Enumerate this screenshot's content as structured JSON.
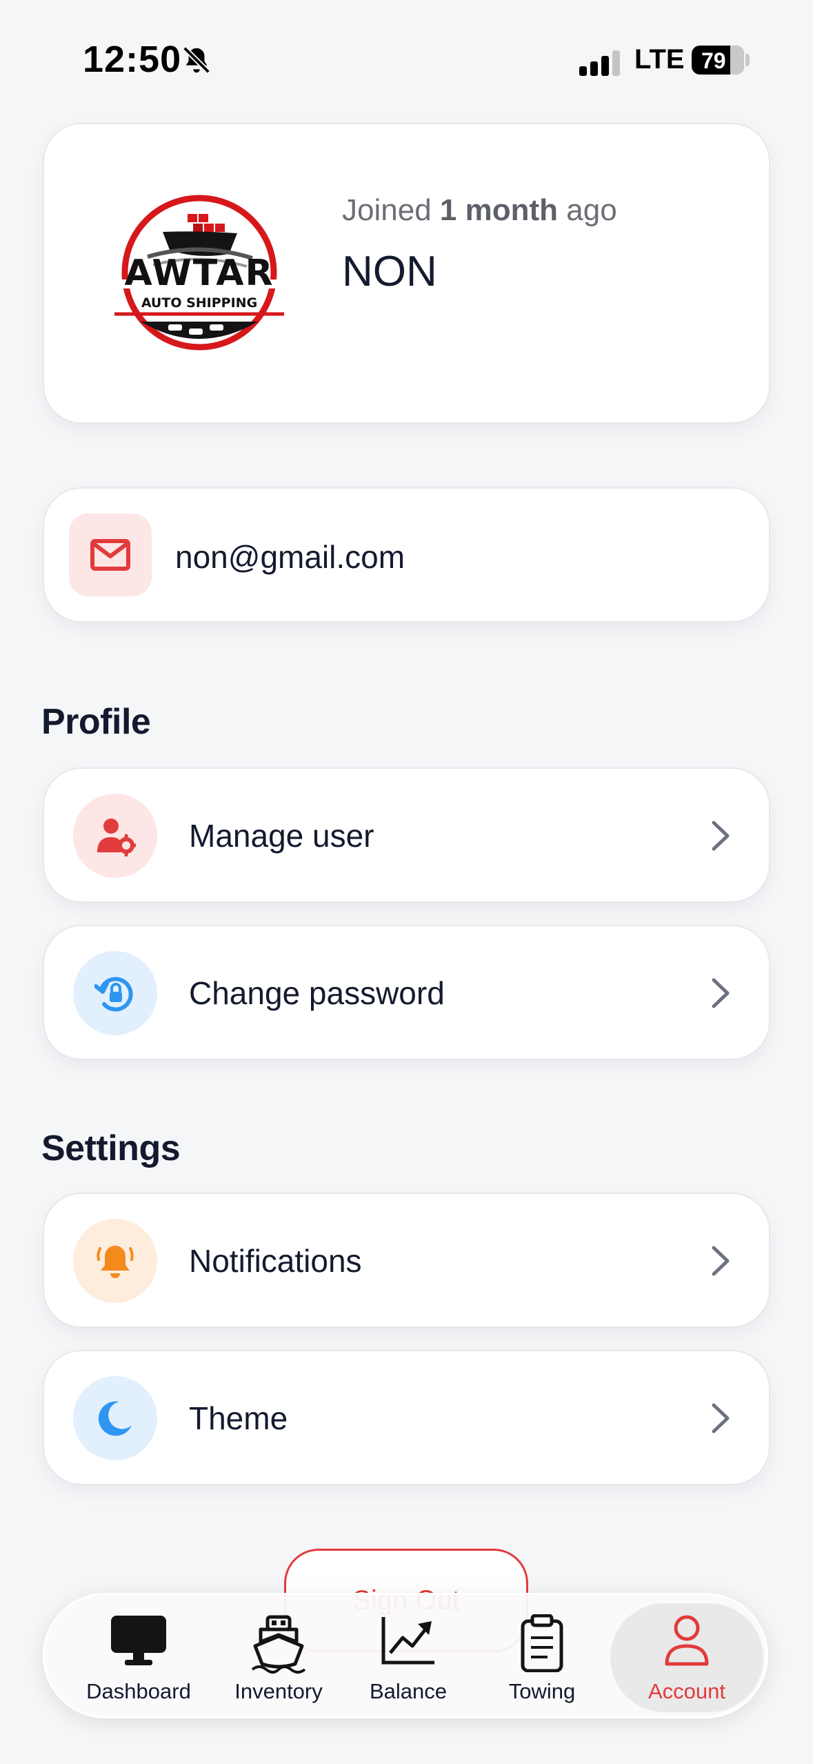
{
  "status_bar": {
    "time": "12:50",
    "network": "LTE",
    "battery": "79"
  },
  "profile": {
    "logo_text": "AWTAR",
    "logo_subtext": "AUTO SHIPPING",
    "joined_prefix": "Joined",
    "joined_value": "1 month",
    "joined_suffix": "ago",
    "name": "NON",
    "email": "non@gmail.com"
  },
  "sections": {
    "profile_title": "Profile",
    "settings_title": "Settings"
  },
  "rows": {
    "manage_user": "Manage user",
    "change_password": "Change password",
    "notifications": "Notifications",
    "theme": "Theme"
  },
  "signout": {
    "label": "Sign Out"
  },
  "nav": {
    "dashboard": "Dashboard",
    "inventory": "Inventory",
    "balance": "Balance",
    "towing": "Towing",
    "account": "Account"
  },
  "colors": {
    "accent": "#e23b3b",
    "blue": "#2e96f0",
    "orange": "#f48a1c",
    "background": "#f5f6f8"
  },
  "icons": {
    "email": "envelope-icon",
    "manage_user": "user-gear-icon",
    "change_password": "lock-reset-icon",
    "notifications": "bell-icon",
    "theme": "moon-icon"
  }
}
